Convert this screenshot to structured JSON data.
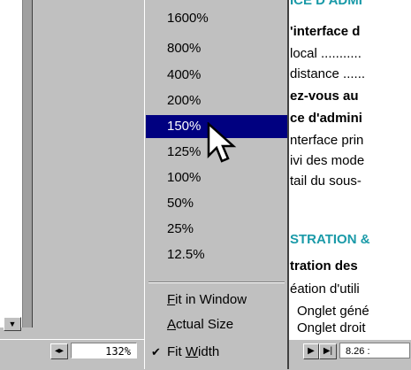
{
  "zoom_menu": {
    "items": [
      {
        "label": "1600%"
      },
      {
        "label": "800%"
      },
      {
        "label": "400%"
      },
      {
        "label": "200%"
      },
      {
        "label": "150%",
        "selected": true
      },
      {
        "label": "125%"
      },
      {
        "label": "100%"
      },
      {
        "label": "50%"
      },
      {
        "label": "25%"
      },
      {
        "label": "12.5%"
      }
    ],
    "fit_in_window": {
      "underline": "F",
      "rest": "it in Window"
    },
    "actual_size": {
      "underline": "A",
      "rest": "ctual Size"
    },
    "fit_width": {
      "prefix": "Fit ",
      "underline": "W",
      "rest": "idth",
      "checked": true
    }
  },
  "status_bar": {
    "zoom_value": "132%",
    "page_indicator": "8.26 :",
    "zoom_arrows_icon": "left-right-arrows-icon",
    "next_page_icon": "triangle-right-icon",
    "last_page_icon": "triangle-right-bar-icon"
  },
  "document": {
    "lines": [
      "'interface d",
      "local ...........",
      "distance ......",
      "ez-vous au",
      "ce d'admini",
      "nterface prin",
      "ivi des mode",
      "tail du sous-",
      "STRATION &",
      "tration des",
      "éation d'utili",
      "Onglet géné",
      "Onglet droit"
    ]
  },
  "colors": {
    "menu_bg": "#c0c0c0",
    "selection": "#000080",
    "heading_teal": "#1a9aa8"
  }
}
